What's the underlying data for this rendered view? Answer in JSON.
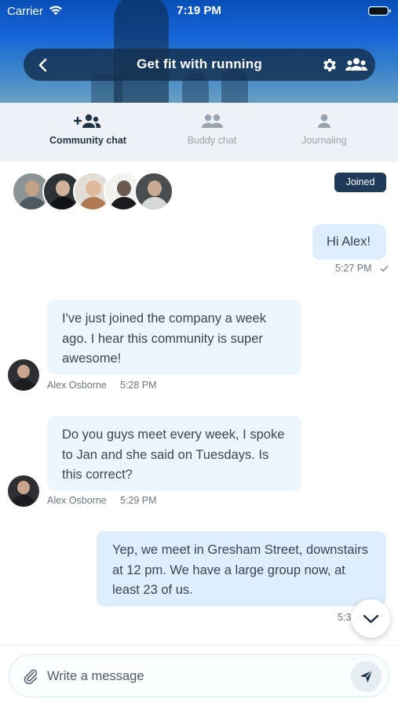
{
  "status_bar": {
    "carrier": "Carrier",
    "time": "7:19 PM"
  },
  "header": {
    "title": "Get fit with running"
  },
  "tabs": [
    {
      "label": "Community chat",
      "active": true,
      "icon": "add-group-icon"
    },
    {
      "label": "Buddy chat",
      "active": false,
      "icon": "two-people-icon"
    },
    {
      "label": "Journaling",
      "active": false,
      "icon": "person-icon"
    }
  ],
  "group": {
    "joined_label": "Joined",
    "member_count_shown": 5
  },
  "messages": [
    {
      "direction": "out",
      "text": "Hi Alex!",
      "time": "5:27 PM",
      "read_icon": "checkmark-icon"
    },
    {
      "direction": "in",
      "sender": "Alex Osborne",
      "text": "I've just joined the company a week ago. I hear this community is super awesome!",
      "time": "5:28 PM"
    },
    {
      "direction": "in",
      "sender": "Alex Osborne",
      "text": "Do you guys meet every week, I spoke to Jan and she said on Tuesdays. Is this correct?",
      "time": "5:29 PM"
    },
    {
      "direction": "out",
      "text": "Yep, we meet in Gresham Street, downstairs at 12 pm. We have a large group now, at least 23 of us.",
      "time": "5:3"
    }
  ],
  "composer": {
    "placeholder": "Write a message"
  },
  "colors": {
    "header_pill": "#14304e",
    "joined_badge": "#1e3a56",
    "bubble_in": "#eef6fd",
    "bubble_out": "#deeefc",
    "tab_bar": "#eef1f5"
  }
}
